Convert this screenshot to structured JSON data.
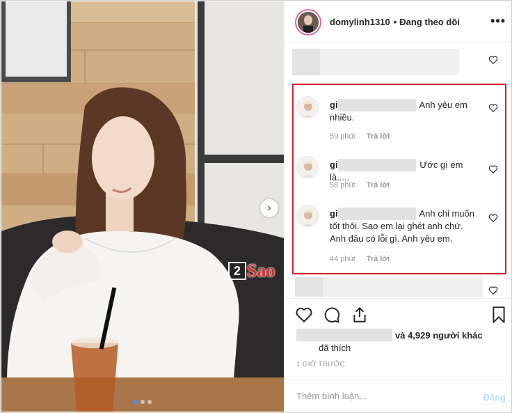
{
  "header": {
    "username": "domylinh1310",
    "separator": "•",
    "follow_status": "Đang theo dõi",
    "more_label": "•••"
  },
  "photo": {
    "watermark_number": "2",
    "watermark_text": "Sao",
    "next_arrow": "›",
    "carousel_count": 3,
    "carousel_active": 1
  },
  "comments": [
    {
      "user": "gi",
      "text": "Anh yêu em nhiều.",
      "time": "59 phút",
      "reply": "Trả lời"
    },
    {
      "user": "gi",
      "text": "Ước gì em là.....",
      "time": "58 phút",
      "reply": "Trả lời"
    },
    {
      "user": "gi",
      "text": "Anh chỉ muốn tốt thôi. Sao em lại ghét anh chứ. Anh đâu có lỗi gì. Anh yêu em.",
      "time": "44 phút",
      "reply": "Trả lời"
    }
  ],
  "likes": {
    "text": "và 4,929 người khác",
    "text2": "đã thích"
  },
  "timestamp": "1 GIỜ TRƯỚC",
  "add_comment": {
    "placeholder": "Thêm bình luận...",
    "post_label": "Đăng"
  },
  "colors": {
    "highlight": "#d2232a",
    "accent": "#3897f0",
    "post_disabled": "#b2dffc"
  },
  "icons": [
    "heart-icon",
    "comment-icon",
    "share-icon",
    "bookmark-icon",
    "more-icon",
    "chevron-right-icon"
  ]
}
